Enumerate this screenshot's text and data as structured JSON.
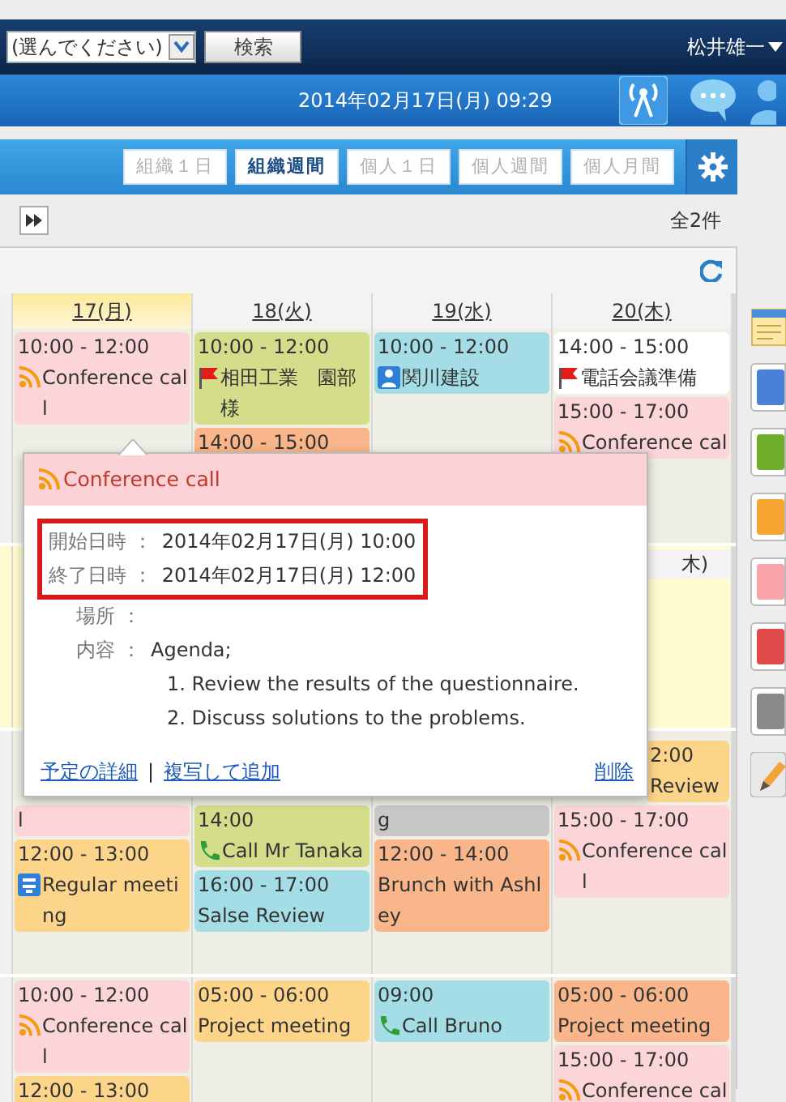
{
  "top_bar": {
    "select": {
      "value": "(選んでください)"
    },
    "search_button": "検索",
    "user": "松井雄一"
  },
  "date_bar": {
    "datetime": "2014年02月17日(月) 09:29"
  },
  "view_tabs": [
    {
      "label": "組織１日",
      "selected": false
    },
    {
      "label": "組織週間",
      "selected": true
    },
    {
      "label": "個人１日",
      "selected": false
    },
    {
      "label": "個人週間",
      "selected": false
    },
    {
      "label": "個人月間",
      "selected": false
    }
  ],
  "pager": {
    "count": "全2件"
  },
  "days": [
    {
      "label": "17(月)",
      "selected": true
    },
    {
      "label": "18(火)",
      "selected": false
    },
    {
      "label": "19(水)",
      "selected": false
    },
    {
      "label": "20(木)",
      "selected": false
    }
  ],
  "weeks": [
    {
      "cells": [
        {
          "events": [
            {
              "time": "10:00 - 12:00",
              "kind": "rss",
              "title": [
                "Conference cal",
                "l"
              ],
              "color": "#fbd5d8"
            }
          ]
        },
        {
          "events": [
            {
              "time": "10:00 - 12:00",
              "kind": "flag",
              "title": [
                "相田工業　園部",
                "様"
              ],
              "color": "#d3dd8a"
            },
            {
              "time": "14:00 - 15:00",
              "color": "#f8b68a"
            }
          ]
        },
        {
          "events": [
            {
              "time": "10:00 - 12:00",
              "kind": "person",
              "title": [
                "関川建設"
              ],
              "color": "#a4dde6"
            }
          ]
        },
        {
          "events": [
            {
              "time": "14:00 - 15:00",
              "kind": "flag",
              "title": [
                "電話会議準備"
              ],
              "color": "#ffffff"
            },
            {
              "time": "15:00 - 17:00",
              "kind": "rss",
              "title": [
                "Conference cal"
              ],
              "color": "#fbd5d8"
            }
          ]
        }
      ]
    },
    {
      "header": "木)"
    },
    {
      "cells": [
        {
          "events": [
            {
              "kind": "plain",
              "title": [
                "l"
              ],
              "color": "#fbd5d8"
            },
            {
              "time": "12:00 - 13:00",
              "kind": "meeting",
              "title": [
                "Regular meeti",
                "ng"
              ],
              "color": "#fdd58a"
            }
          ]
        },
        {
          "events": [
            {
              "time": "14:00",
              "kind": "phone",
              "title": [
                "Call Mr Tanaka"
              ],
              "color": "#d3dd8a"
            },
            {
              "time": "16:00 - 17:00",
              "kind": "plain",
              "title": [
                "Salse Review"
              ],
              "color": "#a4dde6"
            }
          ]
        },
        {
          "events": [
            {
              "kind": "plain",
              "title": [
                "g"
              ],
              "color": "#c8c8c8"
            },
            {
              "time": "12:00 - 14:00",
              "kind": "plain",
              "title": [
                "Brunch with Ashl",
                "ey"
              ],
              "color": "#f8b68a"
            }
          ]
        },
        {
          "events": [
            {
              "time": "2:00",
              "kind": "plain",
              "title": [
                "Review"
              ],
              "color": "#fdd58a"
            },
            {
              "time": "15:00 - 17:00",
              "kind": "rss",
              "title": [
                "Conference cal",
                "l"
              ],
              "color": "#fbd5d8"
            }
          ]
        }
      ]
    },
    {
      "cells": [
        {
          "events": [
            {
              "time": "10:00 - 12:00",
              "kind": "rss",
              "title": [
                "Conference cal",
                "l"
              ],
              "color": "#fbd5d8"
            },
            {
              "time": "12:00 - 13:00",
              "color": "#fdd58a"
            }
          ]
        },
        {
          "events": [
            {
              "time": "05:00 - 06:00",
              "kind": "plain",
              "title": [
                "Project meeting"
              ],
              "color": "#fdd58a"
            }
          ]
        },
        {
          "events": [
            {
              "time": "09:00",
              "kind": "phone",
              "title": [
                "Call Bruno"
              ],
              "color": "#a4dde6"
            }
          ]
        },
        {
          "events": [
            {
              "time": "05:00 - 06:00",
              "kind": "plain",
              "title": [
                "Project meeting"
              ],
              "color": "#f8b68a"
            },
            {
              "time": "15:00 - 17:00",
              "kind": "rss",
              "title": [
                "Conference cal"
              ],
              "color": "#fbd5d8"
            }
          ]
        }
      ]
    }
  ],
  "popup": {
    "kind": "rss",
    "title": "Conference call",
    "fields": [
      {
        "label": "開始日時 ：",
        "value": "2014年02月17日(月) 10:00",
        "highlighted": true
      },
      {
        "label": "終了日時 ：",
        "value": "2014年02月17日(月) 12:00",
        "highlighted": true
      },
      {
        "label": "場所 ：",
        "highlighted": false
      },
      {
        "label": "内容 ：",
        "value": "Agenda;",
        "lines": [
          "1. Review the results of the questionnaire.",
          "2. Discuss solutions to the problems."
        ],
        "highlighted": false
      }
    ],
    "links": [
      "予定の詳細",
      "複写して追加"
    ],
    "link_separator": "|",
    "delete": "削除"
  },
  "palette": [
    {
      "kind": "note"
    },
    {
      "kind": "swatch",
      "color": "#4a80d8"
    },
    {
      "kind": "swatch",
      "color": "#6fae2c"
    },
    {
      "kind": "swatch",
      "color": "#f6a531"
    },
    {
      "kind": "swatch",
      "color": "#f7a3a8"
    },
    {
      "kind": "swatch",
      "color": "#e24a4a"
    },
    {
      "kind": "swatch",
      "color": "#8a8a8a"
    },
    {
      "kind": "pencil"
    }
  ]
}
